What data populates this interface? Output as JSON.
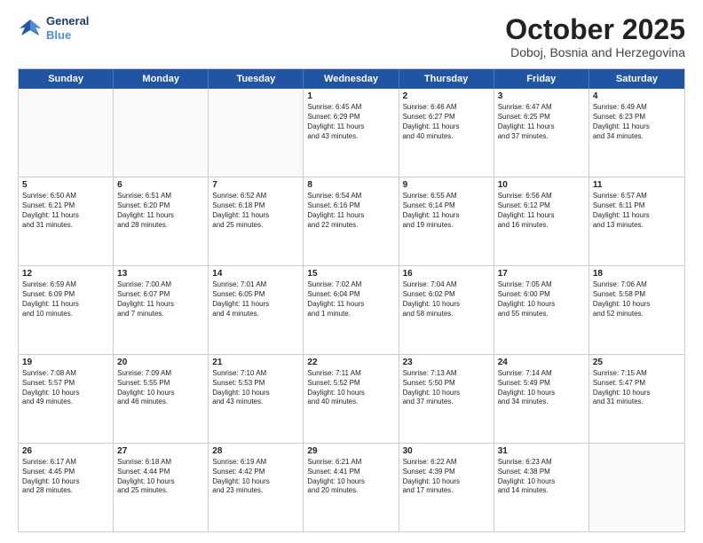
{
  "header": {
    "logo_line1": "General",
    "logo_line2": "Blue",
    "month_title": "October 2025",
    "location": "Doboj, Bosnia and Herzegovina"
  },
  "days_of_week": [
    "Sunday",
    "Monday",
    "Tuesday",
    "Wednesday",
    "Thursday",
    "Friday",
    "Saturday"
  ],
  "rows": [
    [
      {
        "day": "",
        "text": ""
      },
      {
        "day": "",
        "text": ""
      },
      {
        "day": "",
        "text": ""
      },
      {
        "day": "1",
        "text": "Sunrise: 6:45 AM\nSunset: 6:29 PM\nDaylight: 11 hours\nand 43 minutes."
      },
      {
        "day": "2",
        "text": "Sunrise: 6:46 AM\nSunset: 6:27 PM\nDaylight: 11 hours\nand 40 minutes."
      },
      {
        "day": "3",
        "text": "Sunrise: 6:47 AM\nSunset: 6:25 PM\nDaylight: 11 hours\nand 37 minutes."
      },
      {
        "day": "4",
        "text": "Sunrise: 6:49 AM\nSunset: 6:23 PM\nDaylight: 11 hours\nand 34 minutes."
      }
    ],
    [
      {
        "day": "5",
        "text": "Sunrise: 6:50 AM\nSunset: 6:21 PM\nDaylight: 11 hours\nand 31 minutes."
      },
      {
        "day": "6",
        "text": "Sunrise: 6:51 AM\nSunset: 6:20 PM\nDaylight: 11 hours\nand 28 minutes."
      },
      {
        "day": "7",
        "text": "Sunrise: 6:52 AM\nSunset: 6:18 PM\nDaylight: 11 hours\nand 25 minutes."
      },
      {
        "day": "8",
        "text": "Sunrise: 6:54 AM\nSunset: 6:16 PM\nDaylight: 11 hours\nand 22 minutes."
      },
      {
        "day": "9",
        "text": "Sunrise: 6:55 AM\nSunset: 6:14 PM\nDaylight: 11 hours\nand 19 minutes."
      },
      {
        "day": "10",
        "text": "Sunrise: 6:56 AM\nSunset: 6:12 PM\nDaylight: 11 hours\nand 16 minutes."
      },
      {
        "day": "11",
        "text": "Sunrise: 6:57 AM\nSunset: 6:11 PM\nDaylight: 11 hours\nand 13 minutes."
      }
    ],
    [
      {
        "day": "12",
        "text": "Sunrise: 6:59 AM\nSunset: 6:09 PM\nDaylight: 11 hours\nand 10 minutes."
      },
      {
        "day": "13",
        "text": "Sunrise: 7:00 AM\nSunset: 6:07 PM\nDaylight: 11 hours\nand 7 minutes."
      },
      {
        "day": "14",
        "text": "Sunrise: 7:01 AM\nSunset: 6:05 PM\nDaylight: 11 hours\nand 4 minutes."
      },
      {
        "day": "15",
        "text": "Sunrise: 7:02 AM\nSunset: 6:04 PM\nDaylight: 11 hours\nand 1 minute."
      },
      {
        "day": "16",
        "text": "Sunrise: 7:04 AM\nSunset: 6:02 PM\nDaylight: 10 hours\nand 58 minutes."
      },
      {
        "day": "17",
        "text": "Sunrise: 7:05 AM\nSunset: 6:00 PM\nDaylight: 10 hours\nand 55 minutes."
      },
      {
        "day": "18",
        "text": "Sunrise: 7:06 AM\nSunset: 5:58 PM\nDaylight: 10 hours\nand 52 minutes."
      }
    ],
    [
      {
        "day": "19",
        "text": "Sunrise: 7:08 AM\nSunset: 5:57 PM\nDaylight: 10 hours\nand 49 minutes."
      },
      {
        "day": "20",
        "text": "Sunrise: 7:09 AM\nSunset: 5:55 PM\nDaylight: 10 hours\nand 46 minutes."
      },
      {
        "day": "21",
        "text": "Sunrise: 7:10 AM\nSunset: 5:53 PM\nDaylight: 10 hours\nand 43 minutes."
      },
      {
        "day": "22",
        "text": "Sunrise: 7:11 AM\nSunset: 5:52 PM\nDaylight: 10 hours\nand 40 minutes."
      },
      {
        "day": "23",
        "text": "Sunrise: 7:13 AM\nSunset: 5:50 PM\nDaylight: 10 hours\nand 37 minutes."
      },
      {
        "day": "24",
        "text": "Sunrise: 7:14 AM\nSunset: 5:49 PM\nDaylight: 10 hours\nand 34 minutes."
      },
      {
        "day": "25",
        "text": "Sunrise: 7:15 AM\nSunset: 5:47 PM\nDaylight: 10 hours\nand 31 minutes."
      }
    ],
    [
      {
        "day": "26",
        "text": "Sunrise: 6:17 AM\nSunset: 4:45 PM\nDaylight: 10 hours\nand 28 minutes."
      },
      {
        "day": "27",
        "text": "Sunrise: 6:18 AM\nSunset: 4:44 PM\nDaylight: 10 hours\nand 25 minutes."
      },
      {
        "day": "28",
        "text": "Sunrise: 6:19 AM\nSunset: 4:42 PM\nDaylight: 10 hours\nand 23 minutes."
      },
      {
        "day": "29",
        "text": "Sunrise: 6:21 AM\nSunset: 4:41 PM\nDaylight: 10 hours\nand 20 minutes."
      },
      {
        "day": "30",
        "text": "Sunrise: 6:22 AM\nSunset: 4:39 PM\nDaylight: 10 hours\nand 17 minutes."
      },
      {
        "day": "31",
        "text": "Sunrise: 6:23 AM\nSunset: 4:38 PM\nDaylight: 10 hours\nand 14 minutes."
      },
      {
        "day": "",
        "text": ""
      }
    ]
  ]
}
